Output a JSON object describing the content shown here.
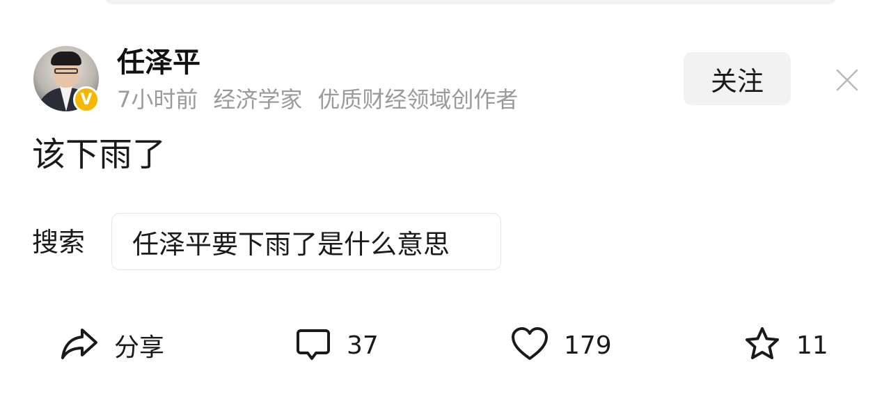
{
  "author": {
    "name": "任泽平",
    "verified_badge": "V",
    "badge_color": "#f5b800",
    "time": "7小时前",
    "title": "经济学家",
    "tag": "优质财经领域创作者"
  },
  "follow_label": "关注",
  "post": {
    "text": "该下雨了"
  },
  "search": {
    "label": "搜索",
    "query": "任泽平要下雨了是什么意思"
  },
  "actions": {
    "share_label": "分享",
    "comment_count": "37",
    "like_count": "179",
    "favorite_count": "11"
  },
  "icons": [
    "avatar",
    "verified-icon",
    "close-icon",
    "share-icon",
    "comment-icon",
    "heart-icon",
    "star-icon"
  ]
}
